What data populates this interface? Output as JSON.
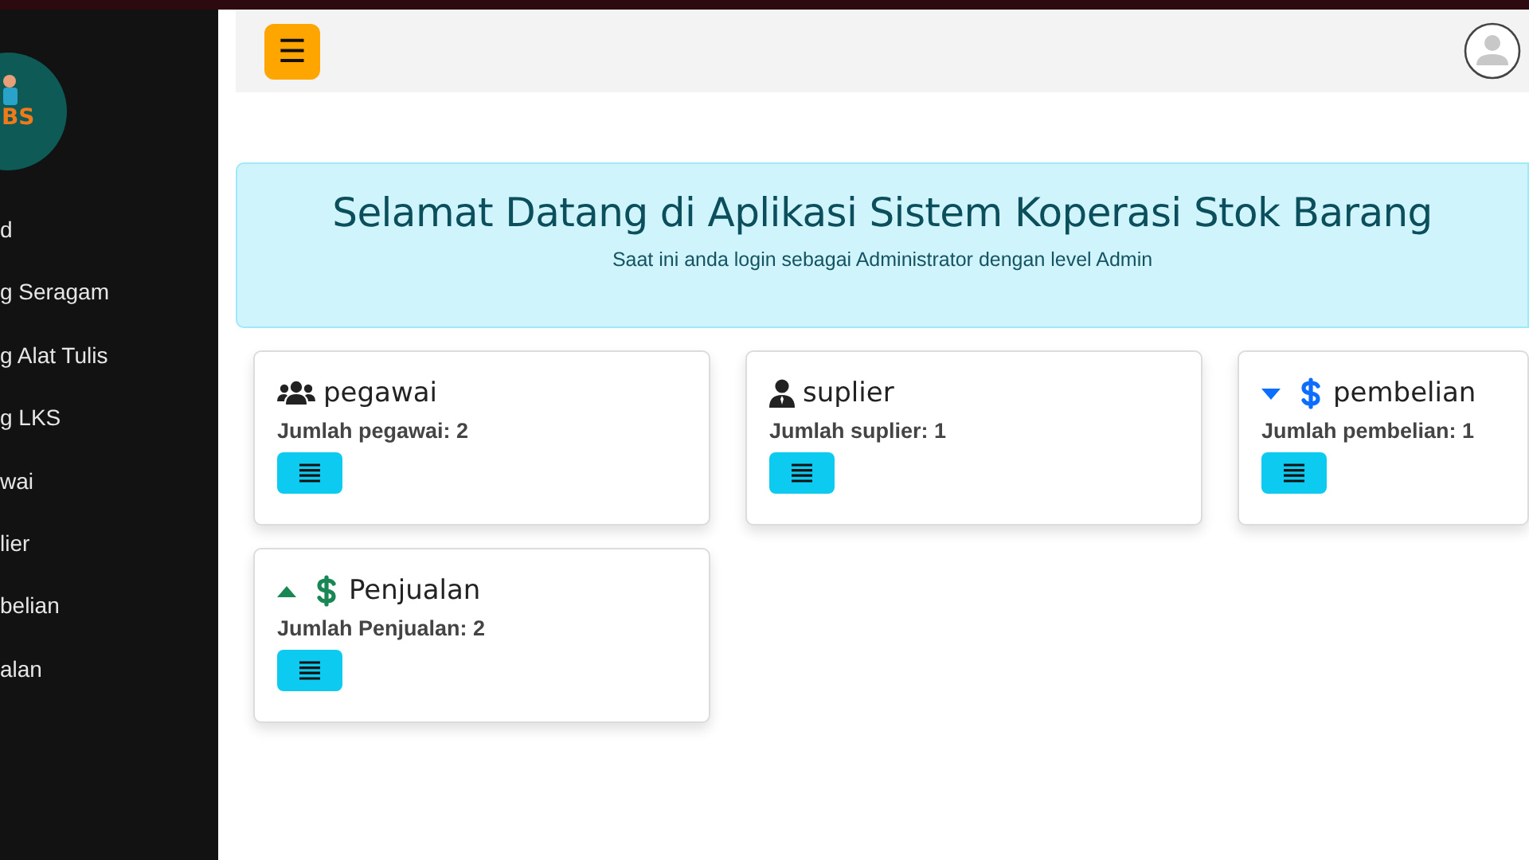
{
  "sidebar": {
    "logo_text": "BS",
    "items": [
      {
        "label": "d"
      },
      {
        "label": "g Seragam"
      },
      {
        "label": "g Alat Tulis"
      },
      {
        "label": "g LKS"
      },
      {
        "label": "wai"
      },
      {
        "label": "lier"
      },
      {
        "label": "belian"
      },
      {
        "label": "alan"
      }
    ]
  },
  "header": {
    "menu_button": "☰"
  },
  "welcome": {
    "title": "Selamat Datang di Aplikasi Sistem Koperasi Stok Barang",
    "subtitle": "Saat ini anda login sebagai Administrator dengan level Admin"
  },
  "cards": [
    {
      "kind": "users",
      "title": "pegawai",
      "count_text": "Jumlah pegawai: 2"
    },
    {
      "kind": "user",
      "title": "suplier",
      "count_text": "Jumlah suplier: 1"
    },
    {
      "kind": "down",
      "title": "pembelian",
      "count_text": "Jumlah pembelian: 1"
    },
    {
      "kind": "up",
      "title": "Penjualan",
      "count_text": "Jumlah Penjualan: 2"
    }
  ]
}
